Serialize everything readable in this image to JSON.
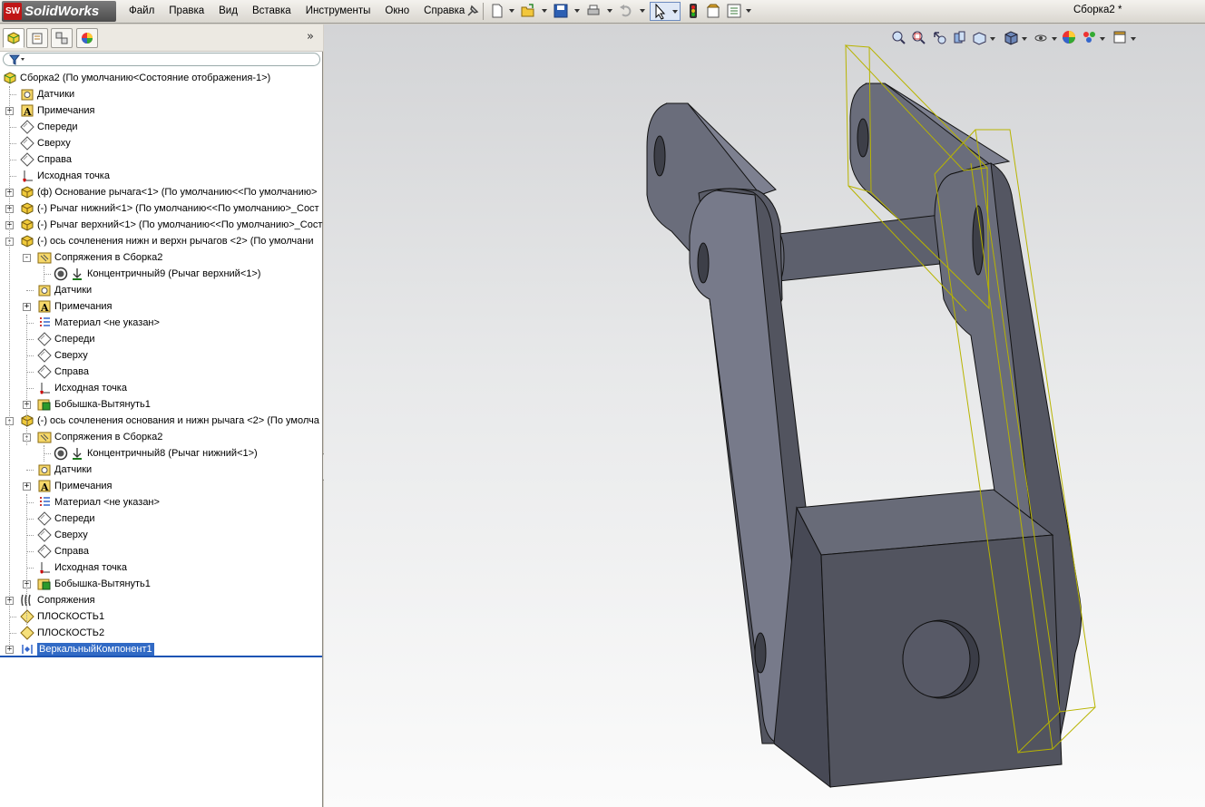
{
  "app": {
    "logo_badge": "SW",
    "logo_text": "SolidWorks",
    "document_title": "Сборка2 *"
  },
  "menu": [
    "Файл",
    "Правка",
    "Вид",
    "Вставка",
    "Инструменты",
    "Окно",
    "Справка"
  ],
  "panel": {
    "collapse_glyph": "»"
  },
  "tree": [
    {
      "label": "Сборка2  (По умолчанию<Состояние отображения-1>)",
      "icon": "assembly-icon",
      "level": 0,
      "expander": null
    },
    {
      "label": "Датчики",
      "icon": "sensors-icon",
      "level": 1,
      "expander": null
    },
    {
      "label": "Примечания",
      "icon": "annotations-icon",
      "level": 1,
      "expander": "+"
    },
    {
      "label": "Спереди",
      "icon": "plane-icon",
      "level": 1,
      "expander": null
    },
    {
      "label": "Сверху",
      "icon": "plane-icon",
      "level": 1,
      "expander": null
    },
    {
      "label": "Справа",
      "icon": "plane-icon",
      "level": 1,
      "expander": null
    },
    {
      "label": "Исходная точка",
      "icon": "origin-icon",
      "level": 1,
      "expander": null
    },
    {
      "label": "(ф) Основание рычага<1> (По умолчанию<<По умолчанию>",
      "icon": "part-icon",
      "level": 1,
      "expander": "+"
    },
    {
      "label": "(-) Рычаг нижний<1> (По умолчанию<<По умолчанию>_Сост",
      "icon": "part-icon",
      "level": 1,
      "expander": "+"
    },
    {
      "label": "(-) Рычаг верхний<1> (По умолчанию<<По умолчанию>_Сост",
      "icon": "part-icon",
      "level": 1,
      "expander": "+"
    },
    {
      "label": "(-) ось сочленения нижн и верхн рычагов <2> (По умолчани",
      "icon": "part-icon",
      "level": 1,
      "expander": "-"
    },
    {
      "label": "Сопряжения в Сборка2",
      "icon": "mates-folder-icon",
      "level": 2,
      "expander": "-"
    },
    {
      "label": "Концентричный9 (Рычаг верхний<1>)",
      "icon": "concentric-mate-icon",
      "level": 3,
      "expander": null
    },
    {
      "label": "Датчики",
      "icon": "sensors-icon",
      "level": 2,
      "expander": null
    },
    {
      "label": "Примечания",
      "icon": "annotations-icon",
      "level": 2,
      "expander": "+"
    },
    {
      "label": "Материал <не указан>",
      "icon": "material-icon",
      "level": 2,
      "expander": null
    },
    {
      "label": "Спереди",
      "icon": "plane-icon",
      "level": 2,
      "expander": null
    },
    {
      "label": "Сверху",
      "icon": "plane-icon",
      "level": 2,
      "expander": null
    },
    {
      "label": "Справа",
      "icon": "plane-icon",
      "level": 2,
      "expander": null
    },
    {
      "label": "Исходная точка",
      "icon": "origin-icon",
      "level": 2,
      "expander": null
    },
    {
      "label": "Бобышка-Вытянуть1",
      "icon": "extrude-icon",
      "level": 2,
      "expander": "+"
    },
    {
      "label": "(-) ось сочленения основания и нижн рычага <2> (По умолча",
      "icon": "part-icon",
      "level": 1,
      "expander": "-"
    },
    {
      "label": "Сопряжения в Сборка2",
      "icon": "mates-folder-icon",
      "level": 2,
      "expander": "-"
    },
    {
      "label": "Концентричный8 (Рычаг нижний<1>)",
      "icon": "concentric-mate-icon",
      "level": 3,
      "expander": null
    },
    {
      "label": "Датчики",
      "icon": "sensors-icon",
      "level": 2,
      "expander": null
    },
    {
      "label": "Примечания",
      "icon": "annotations-icon",
      "level": 2,
      "expander": "+"
    },
    {
      "label": "Материал <не указан>",
      "icon": "material-icon",
      "level": 2,
      "expander": null
    },
    {
      "label": "Спереди",
      "icon": "plane-icon",
      "level": 2,
      "expander": null
    },
    {
      "label": "Сверху",
      "icon": "plane-icon",
      "level": 2,
      "expander": null
    },
    {
      "label": "Справа",
      "icon": "plane-icon",
      "level": 2,
      "expander": null
    },
    {
      "label": "Исходная точка",
      "icon": "origin-icon",
      "level": 2,
      "expander": null
    },
    {
      "label": "Бобышка-Вытянуть1",
      "icon": "extrude-icon",
      "level": 2,
      "expander": "+"
    },
    {
      "label": "Сопряжения",
      "icon": "mates-icon",
      "level": 1,
      "expander": "+"
    },
    {
      "label": "ПЛОСКОСТЬ1",
      "icon": "ref-plane-icon",
      "level": 1,
      "expander": null
    },
    {
      "label": "ПЛОСКОСТЬ2",
      "icon": "ref-plane-icon",
      "level": 1,
      "expander": null
    },
    {
      "label": "ВеркальныйКомпонент1",
      "icon": "mirror-component-icon",
      "level": 1,
      "expander": "+",
      "selected": true
    }
  ],
  "colors": {
    "part_face_dark": "#50525e",
    "part_face_mid": "#6a6d7b",
    "part_face_light": "#7d8090",
    "bbox_outline": "#b8b400",
    "selection": "#316ac5"
  }
}
